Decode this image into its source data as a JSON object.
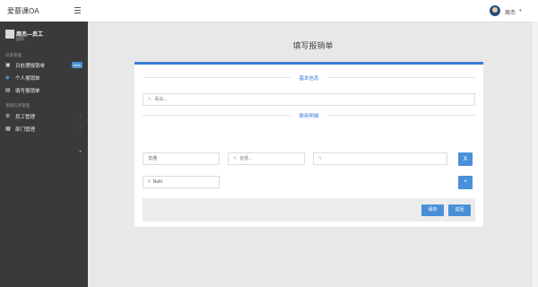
{
  "header": {
    "brand": "爱慕课OA",
    "user_name": "周杰",
    "caret": "▾"
  },
  "sidebar": {
    "user": {
      "name": "周杰—员工",
      "role": "副的"
    },
    "sections": [
      {
        "label": "日常管理",
        "items": [
          {
            "icon": "list-icon",
            "label": "日处理报销单",
            "badge": "New"
          },
          {
            "icon": "circle-icon",
            "label": "个人报销单"
          },
          {
            "icon": "edit-icon",
            "label": "填写报销单"
          }
        ]
      },
      {
        "label": "基础信息管理",
        "items": [
          {
            "icon": "gear-icon",
            "label": "员工管理",
            "chevron": "›"
          },
          {
            "icon": "building-icon",
            "label": "部门管理",
            "chevron": "›"
          }
        ]
      }
    ],
    "collapse_icon": "◂"
  },
  "main": {
    "title": "填写报销单",
    "basic_info_label": "基本信息",
    "cost_detail_label": "费用明细",
    "cause_placeholder": "事由...",
    "row": {
      "type_value": "交通",
      "amount_placeholder": "金额...",
      "note_placeholder": ""
    },
    "remove_label": "X",
    "add_label": "+",
    "total_value": "NaN",
    "save_label": "保存",
    "back_label": "返回"
  }
}
